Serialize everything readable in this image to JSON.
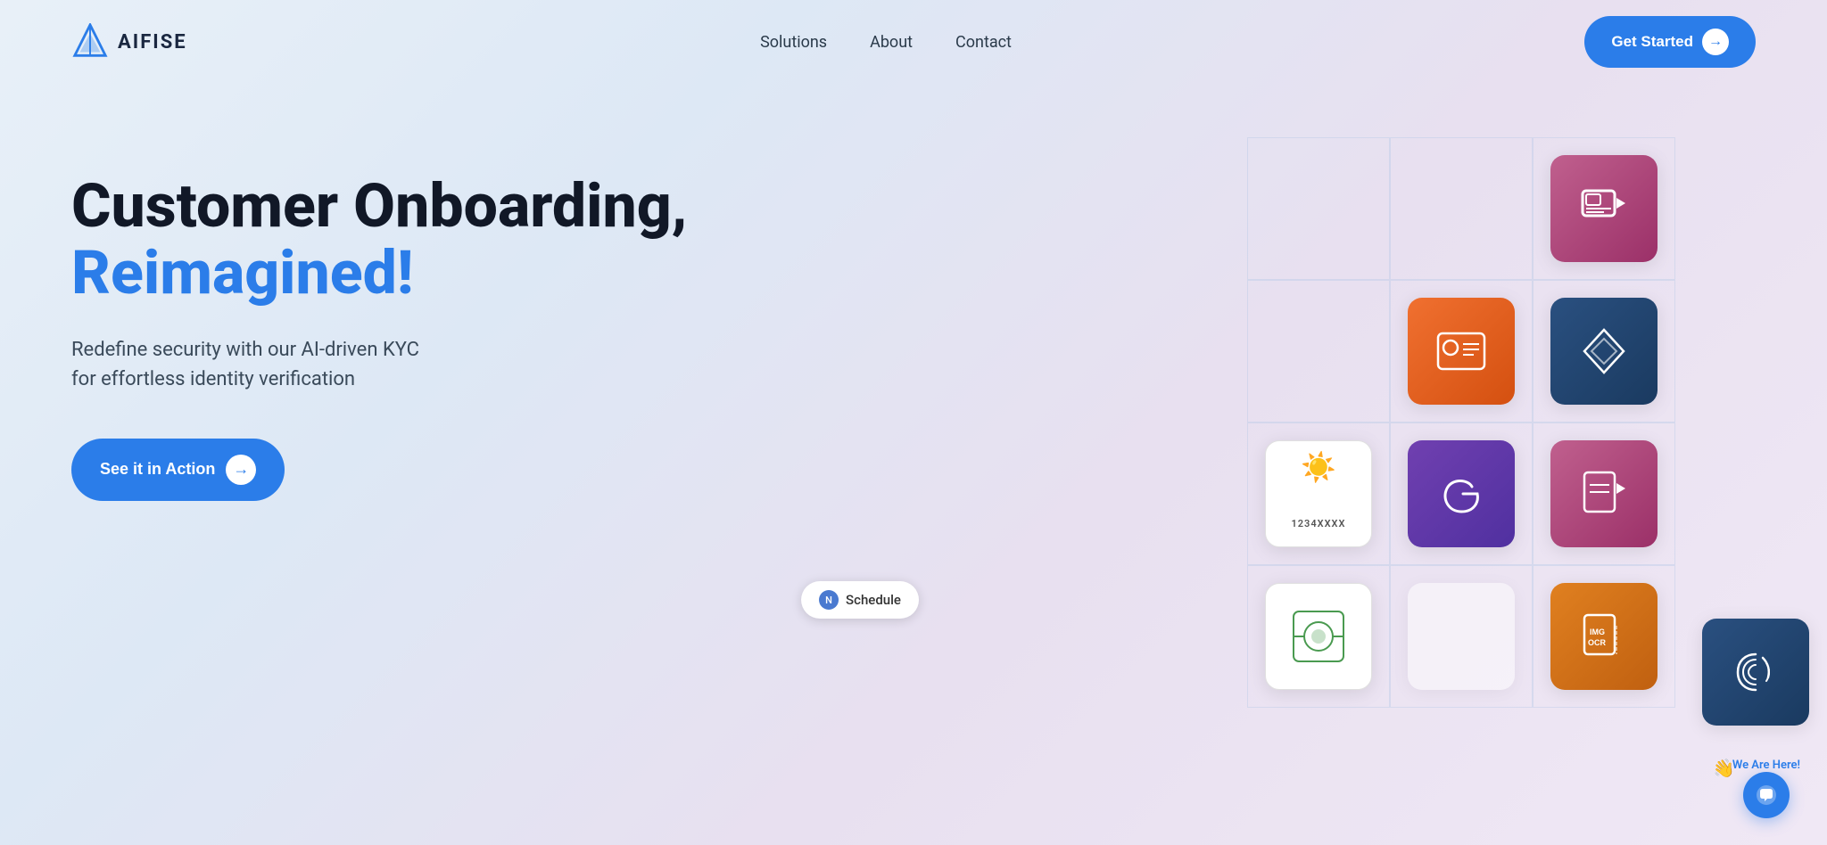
{
  "brand": {
    "logo_text": "AIFISE",
    "logo_icon_alt": "AIFISE logo"
  },
  "navbar": {
    "links": [
      {
        "label": "Solutions",
        "id": "solutions"
      },
      {
        "label": "About",
        "id": "about"
      },
      {
        "label": "Contact",
        "id": "contact"
      }
    ],
    "cta_label": "Get Started"
  },
  "hero": {
    "title_line1": "Customer Onboarding,",
    "title_line2": "Reimagined!",
    "subtitle": "Redefine security with our AI-driven KYC\nfor effortless identity verification",
    "cta_label": "See it in Action"
  },
  "schedule_pill": {
    "label": "Schedule"
  },
  "we_are_here": {
    "text": "We Are Here!",
    "chat_icon": "💬"
  },
  "colors": {
    "accent_blue": "#2b7de9",
    "title_black": "#111827",
    "title_blue": "#2b7de9"
  }
}
